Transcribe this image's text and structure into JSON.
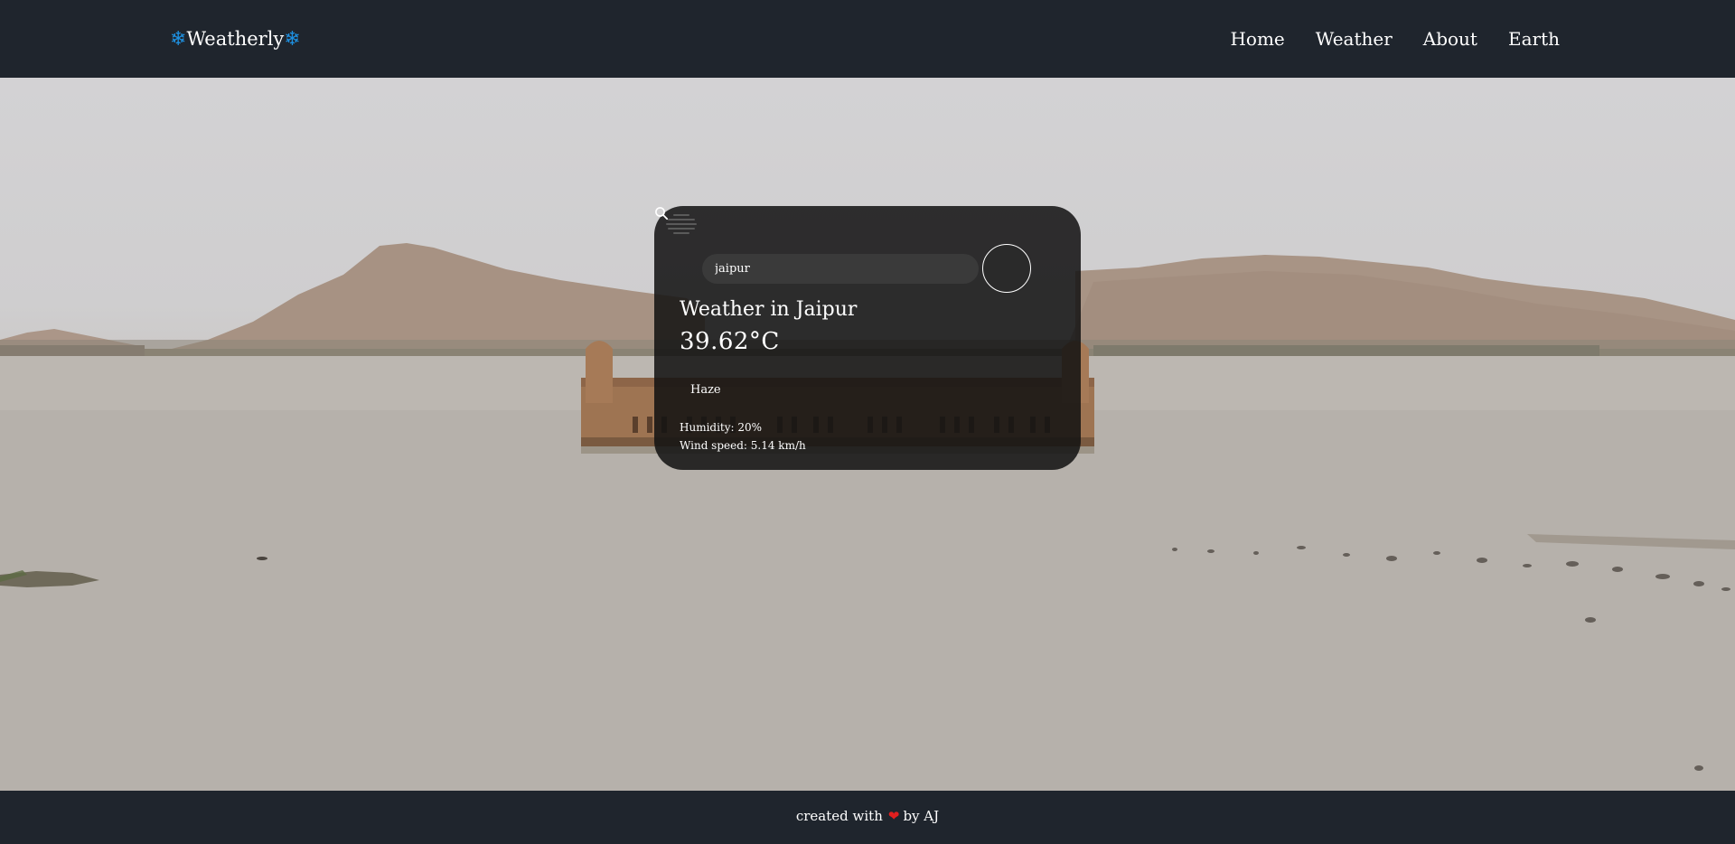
{
  "navbar": {
    "brand": "Weatherly",
    "brand_icon": "snowflake-icon",
    "links": [
      "Home",
      "Weather",
      "About",
      "Earth"
    ]
  },
  "weather": {
    "search_value": "jaipur",
    "search_placeholder": "Search",
    "city": "Weather in Jaipur",
    "temperature": "39.62°C",
    "description": "Haze",
    "condition_icon": "haze-icon",
    "humidity": "Humidity: 20%",
    "wind": "Wind speed: 5.14 km/h"
  },
  "footer": {
    "prefix": "created with",
    "heart_icon": "heart-icon",
    "suffix": "by AJ"
  },
  "colors": {
    "nav_bg": "#1f252d",
    "card_bg": "rgba(17,17,17,0.86)",
    "snowflake": "#1e90e0",
    "heart": "#e01f1f"
  }
}
